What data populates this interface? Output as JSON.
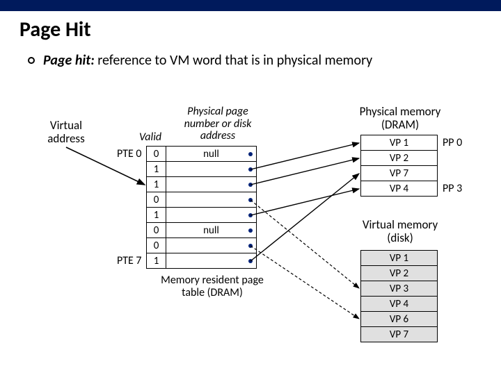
{
  "title": "Page Hit",
  "bullet": {
    "term": "Page hit:",
    "rest": " reference to VM word that is in physical memory"
  },
  "va_label": "Virtual address",
  "pt_headers": {
    "valid": "Valid",
    "addr": "Physical page number or disk address"
  },
  "pt_labels": {
    "first": "PTE 0",
    "last": "PTE 7"
  },
  "pt_rows": [
    {
      "valid": "0",
      "addr": "null"
    },
    {
      "valid": "1",
      "addr": ""
    },
    {
      "valid": "1",
      "addr": ""
    },
    {
      "valid": "0",
      "addr": ""
    },
    {
      "valid": "1",
      "addr": ""
    },
    {
      "valid": "0",
      "addr": "null"
    },
    {
      "valid": "0",
      "addr": ""
    },
    {
      "valid": "1",
      "addr": ""
    }
  ],
  "pt_caption": "Memory resident page table (DRAM)",
  "pm_header": "Physical memory (DRAM)",
  "pm_rows": [
    "VP 1",
    "VP 2",
    "VP 7",
    "VP 4"
  ],
  "pm_labels": {
    "pp0": "PP 0",
    "pp3": "PP 3"
  },
  "vm_header": "Virtual memory (disk)",
  "vm_rows": [
    "VP 1",
    "VP 2",
    "VP 3",
    "VP 4",
    "VP 6",
    "VP 7"
  ],
  "chart_data": {
    "type": "table",
    "title": "Page Hit — Virtual memory page table mapping",
    "page_table": [
      {
        "pte": 0,
        "valid": 0,
        "maps_to": "null"
      },
      {
        "pte": 1,
        "valid": 1,
        "maps_to": "VP1 (PP0)"
      },
      {
        "pte": 2,
        "valid": 1,
        "maps_to": "VP2"
      },
      {
        "pte": 3,
        "valid": 0,
        "maps_to": "VP3 (disk)"
      },
      {
        "pte": 4,
        "valid": 1,
        "maps_to": "VP4 (PP3)"
      },
      {
        "pte": 5,
        "valid": 0,
        "maps_to": "null"
      },
      {
        "pte": 6,
        "valid": 0,
        "maps_to": "VP6 (disk)"
      },
      {
        "pte": 7,
        "valid": 1,
        "maps_to": "VP7"
      }
    ],
    "physical_memory": [
      {
        "pp": 0,
        "contains": "VP 1"
      },
      {
        "pp": 1,
        "contains": "VP 2"
      },
      {
        "pp": 2,
        "contains": "VP 7"
      },
      {
        "pp": 3,
        "contains": "VP 4"
      }
    ],
    "virtual_memory_disk": [
      "VP 1",
      "VP 2",
      "VP 3",
      "VP 4",
      "VP 6",
      "VP 7"
    ],
    "virtual_address_points_to_pte": 2
  }
}
